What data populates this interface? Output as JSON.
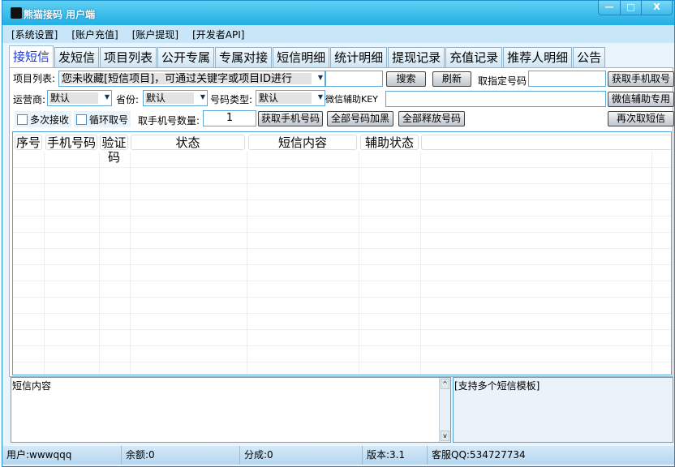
{
  "window": {
    "title": "熊猫接码 用户端",
    "minimize": "—",
    "maximize": "□",
    "close": "X"
  },
  "menu": [
    "[系统设置]",
    "[账户充值]",
    "[账户提现]",
    "[开发者API]"
  ],
  "tabs": [
    "接短信",
    "发短信",
    "项目列表",
    "公开专属",
    "专属对接",
    "短信明细",
    "统计明细",
    "提现记录",
    "充值记录",
    "推荐人明细",
    "公告"
  ],
  "form": {
    "project_label": "项目列表:",
    "project_value": "您未收藏[短信项目]，可通过关键字或项目ID进行",
    "search_value": "",
    "search_btn": "搜索",
    "refresh_btn": "刷新",
    "specific_label": "取指定号码",
    "specific_value": "",
    "get_phone_btn": "获取手机取号",
    "carrier_label": "运营商:",
    "carrier_value": "默认",
    "province_label": "省份:",
    "province_value": "默认",
    "numtype_label": "号码类型:",
    "numtype_value": "默认",
    "wechat_label": "微信辅助KEY",
    "wechat_value": "",
    "wechat_btn": "微信辅助专用",
    "multi_recv": "多次接收",
    "loop_get": "循环取号",
    "qty_label": "取手机号数量:",
    "qty_value": "1",
    "get_number_btn": "获取手机号码",
    "blacklist_btn": "全部号码加黑",
    "release_btn": "全部释放号码",
    "resend_btn": "再次取短信"
  },
  "table": {
    "columns": [
      "序号",
      "手机号码",
      "验证码",
      "状态",
      "短信内容",
      "辅助状态"
    ],
    "rows": []
  },
  "sms": {
    "content": "短信内容",
    "template_hint": "[支持多个短信模板]"
  },
  "status": {
    "user": "用户:wwwqqq",
    "balance": "余额:0",
    "share": "分成:0",
    "version": "版本:3.1",
    "support": "客服QQ:534727734"
  }
}
